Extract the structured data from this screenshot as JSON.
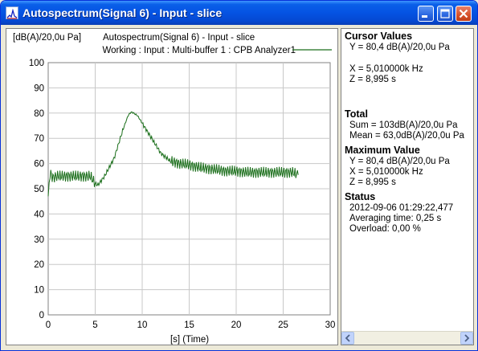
{
  "window": {
    "title": "Autospectrum(Signal 6) - Input - slice",
    "buttons": [
      "minimize",
      "maximize",
      "close"
    ]
  },
  "plot": {
    "unit_label": "[dB(A)/20,0u Pa]",
    "header_title": "Autospectrum(Signal 6) - Input - slice",
    "legend_label": "Working : Input : Multi-buffer 1 : CPB Analyzer1",
    "line_color": "#1a6e1a"
  },
  "chart_data": {
    "type": "line",
    "xlabel": "[s] (Time)",
    "ylabel": "[dB(A)/20,0u Pa]",
    "xlim": [
      0,
      30
    ],
    "ylim": [
      0,
      100
    ],
    "x_ticks": [
      0,
      5,
      10,
      15,
      20,
      25,
      30
    ],
    "y_ticks": [
      0,
      10,
      20,
      30,
      40,
      50,
      60,
      70,
      80,
      90,
      100
    ],
    "grid": true,
    "series": [
      {
        "name": "Working : Input : Multi-buffer 1 : CPB Analyzer1",
        "x": [
          0,
          0.2,
          0.5,
          1,
          2,
          3,
          4,
          4.5,
          5,
          5.3,
          6,
          7,
          7.5,
          8,
          8.5,
          8.8,
          9,
          9.5,
          10,
          10.5,
          11,
          12,
          13,
          14,
          15,
          16,
          17,
          18,
          19,
          20,
          21,
          22,
          23,
          24,
          25,
          26,
          26.6
        ],
        "y": [
          47,
          56,
          54.5,
          55,
          55,
          55,
          55,
          55,
          52,
          51.5,
          55,
          62,
          68,
          74,
          79,
          80.4,
          80.2,
          79,
          76,
          73,
          70,
          64,
          61,
          60,
          59.5,
          58.5,
          58,
          57.5,
          57,
          57,
          56.5,
          56.5,
          56.5,
          56.5,
          56.5,
          56.5,
          55.5
        ]
      }
    ]
  },
  "cursor_panel": {
    "cursor_values": {
      "heading": "Cursor Values",
      "lines": [
        "Y = 80,4 dB(A)/20,0u Pa",
        "",
        "X = 5,010000k Hz",
        "Z = 8,995 s"
      ]
    },
    "total": {
      "heading": "Total",
      "lines": [
        "Sum = 103dB(A)/20,0u Pa",
        "Mean = 63,0dB(A)/20,0u Pa"
      ]
    },
    "maximum_value": {
      "heading": "Maximum Value",
      "lines": [
        "Y = 80,4 dB(A)/20,0u Pa",
        "X = 5,010000k Hz",
        "Z = 8,995 s"
      ]
    },
    "status": {
      "heading": "Status",
      "lines": [
        "2012-09-06  01:29:22,477",
        "Averaging time:     0,25 s",
        "Overload:   0,00 %"
      ]
    }
  }
}
